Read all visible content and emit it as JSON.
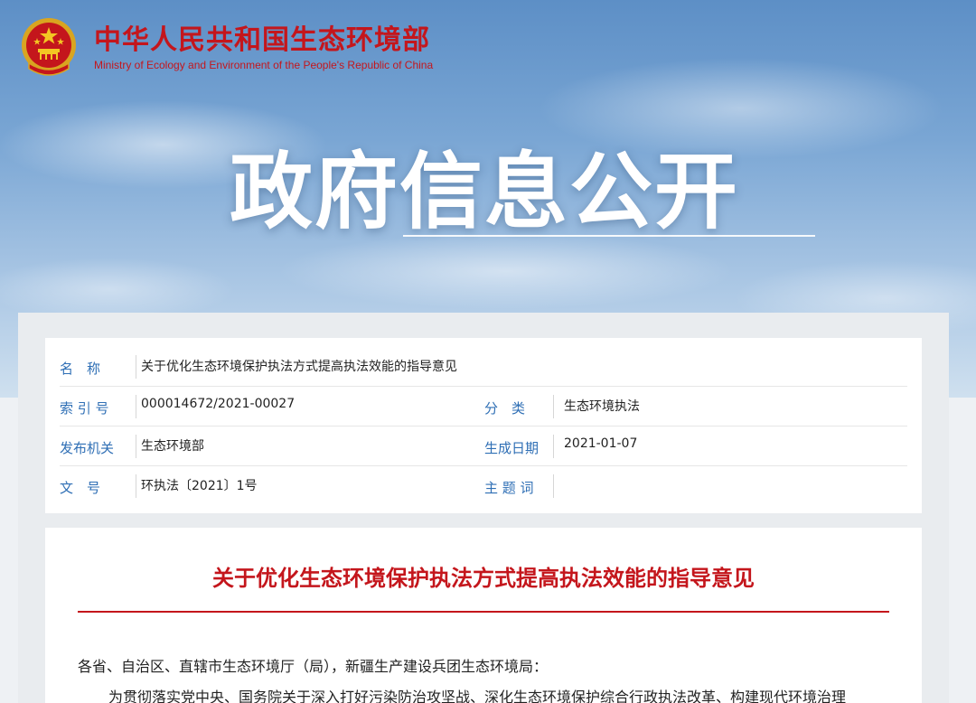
{
  "header": {
    "site_name_cn": "中华人民共和国生态环境部",
    "site_name_en": "Ministry of Ecology and Environment of the People's Republic of China",
    "emblem_icon": "national-emblem-icon",
    "banner_title": "政府信息公开"
  },
  "meta": {
    "name_label": "名　称",
    "name_value": "关于优化生态环境保护执法方式提高执法效能的指导意见",
    "index_label": "索 引 号",
    "index_value": "000014672/2021-00027",
    "category_label": "分　类",
    "category_value": "生态环境执法",
    "issuer_label": "发布机关",
    "issuer_value": "生态环境部",
    "date_label": "生成日期",
    "date_value": "2021-01-07",
    "docno_label": "文　号",
    "docno_value": "环执法〔2021〕1号",
    "topic_label": "主 题 词",
    "topic_value": ""
  },
  "document": {
    "title": "关于优化生态环境保护执法方式提高执法效能的指导意见",
    "salutation": "各省、自治区、直辖市生态环境厅（局），新疆生产建设兵团生态环境局：",
    "first_line": "为贯彻落实党中央、国务院关于深入打好污染防治攻坚战、深化生态环境保护综合行政执法改革、构建现代环境治理"
  },
  "colors": {
    "brand_red": "#c4161c",
    "label_blue": "#2f6fb5"
  }
}
